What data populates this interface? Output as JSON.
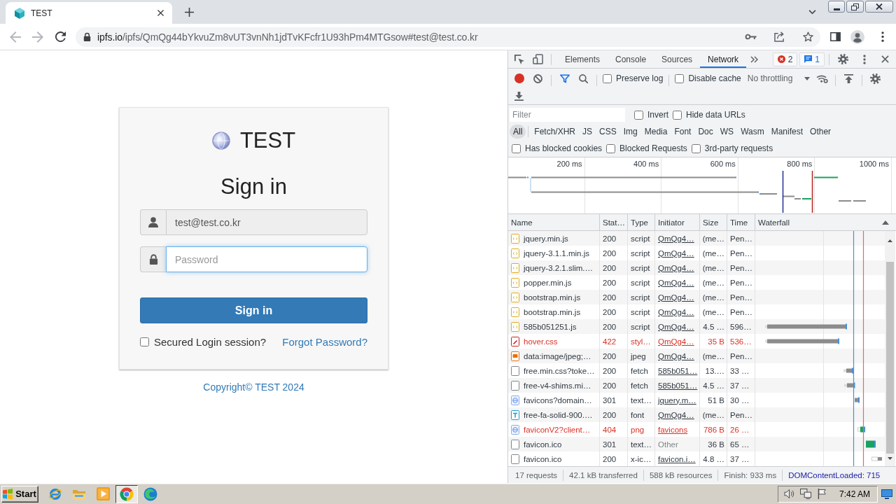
{
  "browser": {
    "tab": {
      "title": "TEST"
    },
    "back": {
      "disabled": true
    },
    "forward": {
      "disabled": true
    },
    "url": {
      "host": "ipfs.io",
      "path": "/ipfs/QmQg44bYkvuZm8vUT3vnNh1jdTvKFcfr1U93hPm4MTGsow#test@test.co.kr"
    }
  },
  "page": {
    "brand": "TEST",
    "heading": "Sign in",
    "email": {
      "value": "test@test.co.kr",
      "readonly": true
    },
    "password": {
      "placeholder": "Password",
      "focused": true
    },
    "submit": "Sign in",
    "remember": {
      "label": "Secured Login session?",
      "checked": false
    },
    "forgot_link": "Forgot Password?",
    "footer": "Copyright© TEST 2024"
  },
  "devtools": {
    "tabs": [
      {
        "label": "Elements",
        "selected": false
      },
      {
        "label": "Console",
        "selected": false
      },
      {
        "label": "Sources",
        "selected": false
      },
      {
        "label": "Network",
        "selected": true
      }
    ],
    "badges": [
      {
        "kind": "error",
        "count": "2"
      },
      {
        "kind": "message",
        "count": "1"
      }
    ],
    "toolbar": {
      "recording": true,
      "filter_active": true,
      "options": [
        {
          "label": "Preserve log",
          "checked": false
        },
        {
          "label": "Disable cache",
          "checked": false
        }
      ],
      "throttling": "No throttling"
    },
    "filter": {
      "placeholder": "Filter",
      "options": [
        {
          "label": "Invert",
          "checked": false
        },
        {
          "label": "Hide data URLs",
          "checked": false
        }
      ]
    },
    "type_filters": [
      {
        "label": "All",
        "selected": true
      },
      {
        "label": "Fetch/XHR",
        "selected": false
      },
      {
        "label": "JS",
        "selected": false
      },
      {
        "label": "CSS",
        "selected": false
      },
      {
        "label": "Img",
        "selected": false
      },
      {
        "label": "Media",
        "selected": false
      },
      {
        "label": "Font",
        "selected": false
      },
      {
        "label": "Doc",
        "selected": false
      },
      {
        "label": "WS",
        "selected": false
      },
      {
        "label": "Wasm",
        "selected": false
      },
      {
        "label": "Manifest",
        "selected": false
      },
      {
        "label": "Other",
        "selected": false
      }
    ],
    "request_filters": [
      {
        "label": "Has blocked cookies",
        "checked": false
      },
      {
        "label": "Blocked Requests",
        "checked": false
      },
      {
        "label": "3rd-party requests",
        "checked": false
      }
    ],
    "overview": {
      "ticks": [
        "200 ms",
        "400 ms",
        "600 ms",
        "800 ms",
        "1000 ms"
      ]
    },
    "table": {
      "columns": [
        "Name",
        "Stat…",
        "Type",
        "Initiator",
        "Size",
        "Time",
        "Waterfall"
      ],
      "rows": [
        {
          "kind": "script",
          "name": "jquery.min.js",
          "status": "200",
          "type": "script",
          "initiator": "QmQg4…",
          "initiator_linked": true,
          "size": "(me…",
          "time": "Pen…",
          "error": false
        },
        {
          "kind": "script",
          "name": "jquery-3.1.1.min.js",
          "status": "200",
          "type": "script",
          "initiator": "QmQg4…",
          "initiator_linked": true,
          "size": "(me…",
          "time": "Pen…",
          "error": false
        },
        {
          "kind": "script",
          "name": "jquery-3.2.1.slim.…",
          "status": "200",
          "type": "script",
          "initiator": "QmQg4…",
          "initiator_linked": true,
          "size": "(me…",
          "time": "Pen…",
          "error": false
        },
        {
          "kind": "script",
          "name": "popper.min.js",
          "status": "200",
          "type": "script",
          "initiator": "QmQg4…",
          "initiator_linked": true,
          "size": "(me…",
          "time": "Pen…",
          "error": false
        },
        {
          "kind": "script",
          "name": "bootstrap.min.js",
          "status": "200",
          "type": "script",
          "initiator": "QmQg4…",
          "initiator_linked": true,
          "size": "(me…",
          "time": "Pen…",
          "error": false
        },
        {
          "kind": "script",
          "name": "bootstrap.min.js",
          "status": "200",
          "type": "script",
          "initiator": "QmQg4…",
          "initiator_linked": true,
          "size": "(me…",
          "time": "Pen…",
          "error": false
        },
        {
          "kind": "script",
          "name": "585b051251.js",
          "status": "200",
          "type": "script",
          "initiator": "QmQg4…",
          "initiator_linked": true,
          "size": "4.5 …",
          "time": "596…",
          "error": false
        },
        {
          "kind": "stylesheet",
          "name": "hover.css",
          "status": "422",
          "type": "styl…",
          "initiator": "QmQg4…",
          "initiator_linked": true,
          "size": "35 B",
          "time": "536…",
          "error": true
        },
        {
          "kind": "image",
          "name": "data:image/jpeg;…",
          "status": "200",
          "type": "jpeg",
          "initiator": "QmQg4…",
          "initiator_linked": true,
          "size": "(me…",
          "time": "Pen…",
          "error": false
        },
        {
          "kind": "document",
          "name": "free.min.css?toke…",
          "status": "200",
          "type": "fetch",
          "initiator": "585b051…",
          "initiator_linked": true,
          "size": "13.…",
          "time": "33 …",
          "error": false
        },
        {
          "kind": "document",
          "name": "free-v4-shims.mi…",
          "status": "200",
          "type": "fetch",
          "initiator": "585b051…",
          "initiator_linked": true,
          "size": "4.5 …",
          "time": "37 …",
          "error": false
        },
        {
          "kind": "favicon",
          "name": "favicons?domain…",
          "status": "301",
          "type": "text…",
          "initiator": "jquery.m…",
          "initiator_linked": true,
          "size": "51 B",
          "time": "30 …",
          "error": false
        },
        {
          "kind": "font",
          "name": "free-fa-solid-900.…",
          "status": "200",
          "type": "font",
          "initiator": "QmQg4…",
          "initiator_linked": true,
          "size": "(me…",
          "time": "Pen…",
          "error": false
        },
        {
          "kind": "favicon",
          "name": "faviconV2?client…",
          "status": "404",
          "type": "png",
          "initiator": "favicons",
          "initiator_linked": true,
          "size": "786 B",
          "time": "26 …",
          "error": true
        },
        {
          "kind": "document",
          "name": "favicon.ico",
          "status": "301",
          "type": "text…",
          "initiator": "Other",
          "initiator_linked": false,
          "size": "36 B",
          "time": "65 …",
          "error": false
        },
        {
          "kind": "document",
          "name": "favicon.ico",
          "status": "200",
          "type": "x-ic…",
          "initiator": "favicon.i…",
          "initiator_linked": true,
          "size": "4.8 …",
          "time": "37 …",
          "error": false
        }
      ]
    },
    "summary": {
      "requests": "17 requests",
      "transferred": "42.1 kB transferred",
      "resources": "588 kB resources",
      "finish": "Finish: 933 ms",
      "dom_content_loaded": "DOMContentLoaded: 715"
    }
  },
  "taskbar": {
    "start": "Start",
    "apps": [
      {
        "kind": "ie",
        "selected": false
      },
      {
        "kind": "folder",
        "selected": false
      },
      {
        "kind": "media",
        "selected": false
      },
      {
        "kind": "chrome",
        "selected": true
      },
      {
        "kind": "edge",
        "selected": false
      }
    ],
    "clock": "7:42 AM"
  }
}
